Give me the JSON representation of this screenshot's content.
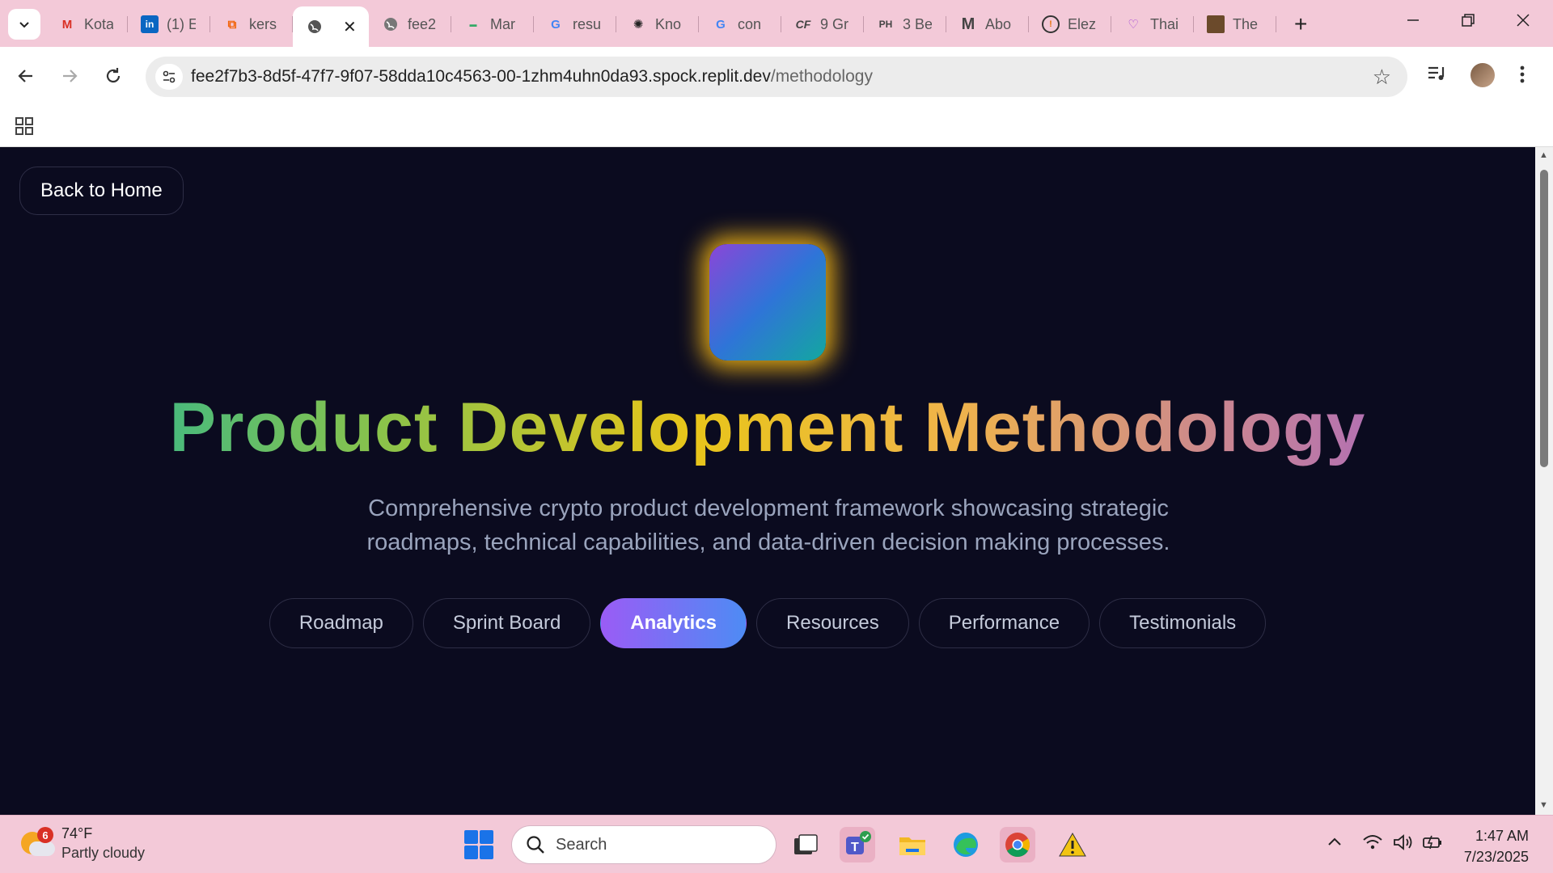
{
  "browser": {
    "tabs": [
      {
        "title": "Kota",
        "icon": "gmail-icon"
      },
      {
        "title": "(1) E",
        "icon": "linkedin-icon"
      },
      {
        "title": "kers",
        "icon": "replit-icon"
      },
      {
        "title": "",
        "icon": "globe-icon",
        "active": true
      },
      {
        "title": "fee2",
        "icon": "globe-icon"
      },
      {
        "title": "Mar",
        "icon": "site-icon"
      },
      {
        "title": "resu",
        "icon": "google-icon"
      },
      {
        "title": "Kno",
        "icon": "openai-icon"
      },
      {
        "title": "con",
        "icon": "google-icon"
      },
      {
        "title": "9 Gr",
        "icon": "cf-icon"
      },
      {
        "title": "3 Be",
        "icon": "ph-icon"
      },
      {
        "title": "Abo",
        "icon": "medium-icon"
      },
      {
        "title": "Elez",
        "icon": "elez-icon"
      },
      {
        "title": "Thai",
        "icon": "heart-icon"
      },
      {
        "title": "The",
        "icon": "image-icon"
      }
    ],
    "close_glyph": "✕",
    "new_tab_glyph": "+",
    "url_host": "fee2f7b3-8d5f-47f7-9f07-58dda10c4563-00-1zhm4uhn0da93.spock.replit.dev",
    "url_path": "/methodology"
  },
  "page": {
    "back_button": "Back to Home",
    "title": "Product Development Methodology",
    "subtitle": "Comprehensive crypto product development framework showcasing strategic roadmaps, technical capabilities, and data-driven decision making processes.",
    "nav": [
      {
        "label": "Roadmap",
        "active": false
      },
      {
        "label": "Sprint Board",
        "active": false
      },
      {
        "label": "Analytics",
        "active": true
      },
      {
        "label": "Resources",
        "active": false
      },
      {
        "label": "Performance",
        "active": false
      },
      {
        "label": "Testimonials",
        "active": false
      }
    ]
  },
  "taskbar": {
    "weather_badge": "6",
    "temperature": "74°F",
    "condition": "Partly cloudy",
    "search_placeholder": "Search",
    "time": "1:47 AM",
    "date": "7/23/2025"
  },
  "colors": {
    "page_bg": "#0b0b1f",
    "chrome_frame": "#f3c9d8",
    "active_pill_start": "#9a5cf5",
    "active_pill_end": "#4e8bf4",
    "logo_glow": "#ffbe14"
  }
}
